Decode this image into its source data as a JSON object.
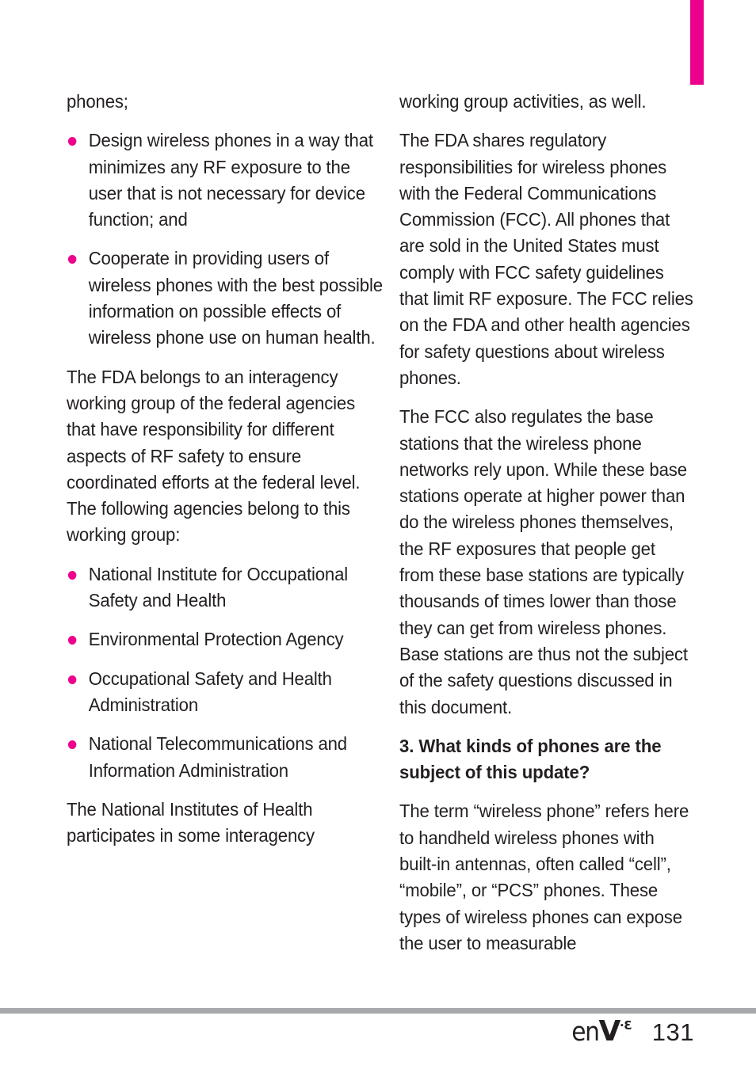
{
  "page": {
    "number": "131",
    "brand_prefix": "en",
    "brand_v": "V",
    "brand_superscript_dot": "·",
    "brand_superscript_number": "3",
    "accent_color": "#EC008C",
    "rule_color": "#a7a9ac",
    "text_color": "#231f20",
    "background_color": "#ffffff"
  },
  "left_column": {
    "blocks": [
      {
        "type": "paragraph",
        "text": "phones;"
      },
      {
        "type": "bullets",
        "items": [
          "Design wireless phones in a way that minimizes any RF exposure to the user that is not necessary for device function; and",
          "Cooperate in providing users of wireless phones with the best possible information on possible effects of wireless phone use on human health."
        ]
      },
      {
        "type": "paragraph",
        "text": "The FDA belongs to an interagency working group of the federal agencies that have responsibility for different aspects of RF safety to ensure coordinated efforts at the federal level. The following agencies belong to this working group:"
      },
      {
        "type": "bullets",
        "items": [
          "National Institute for Occupational Safety and Health",
          "Environmental Protection Agency",
          "Occupational Safety and Health Administration",
          "National Telecommunications and Information Administration"
        ]
      },
      {
        "type": "paragraph",
        "text": "The National Institutes of Health participates in some interagency"
      }
    ]
  },
  "right_column": {
    "blocks": [
      {
        "type": "paragraph",
        "text": "working group activities, as well."
      },
      {
        "type": "paragraph",
        "text": "The FDA shares regulatory responsibilities for wireless phones with the Federal Communications Commission (FCC). All phones that are sold in the United States must comply with FCC safety guidelines that limit RF exposure. The FCC relies on the FDA and other health agencies for safety questions about wireless phones."
      },
      {
        "type": "paragraph",
        "text": "The FCC also regulates the base stations that the wireless phone networks rely upon. While these base stations operate at higher power than do the wireless phones themselves, the RF exposures that people get from these base stations are typically thousands of times lower than those they can get from wireless phones. Base stations are thus not the subject of the safety questions discussed in this document."
      },
      {
        "type": "heading",
        "text": "3. What kinds of phones are the subject of this update?"
      },
      {
        "type": "paragraph",
        "text": "The term “wireless phone” refers here to handheld wireless phones with built-in antennas, often called “cell”, “mobile”, or “PCS” phones. These types of wireless phones can expose the user to measurable"
      }
    ]
  }
}
